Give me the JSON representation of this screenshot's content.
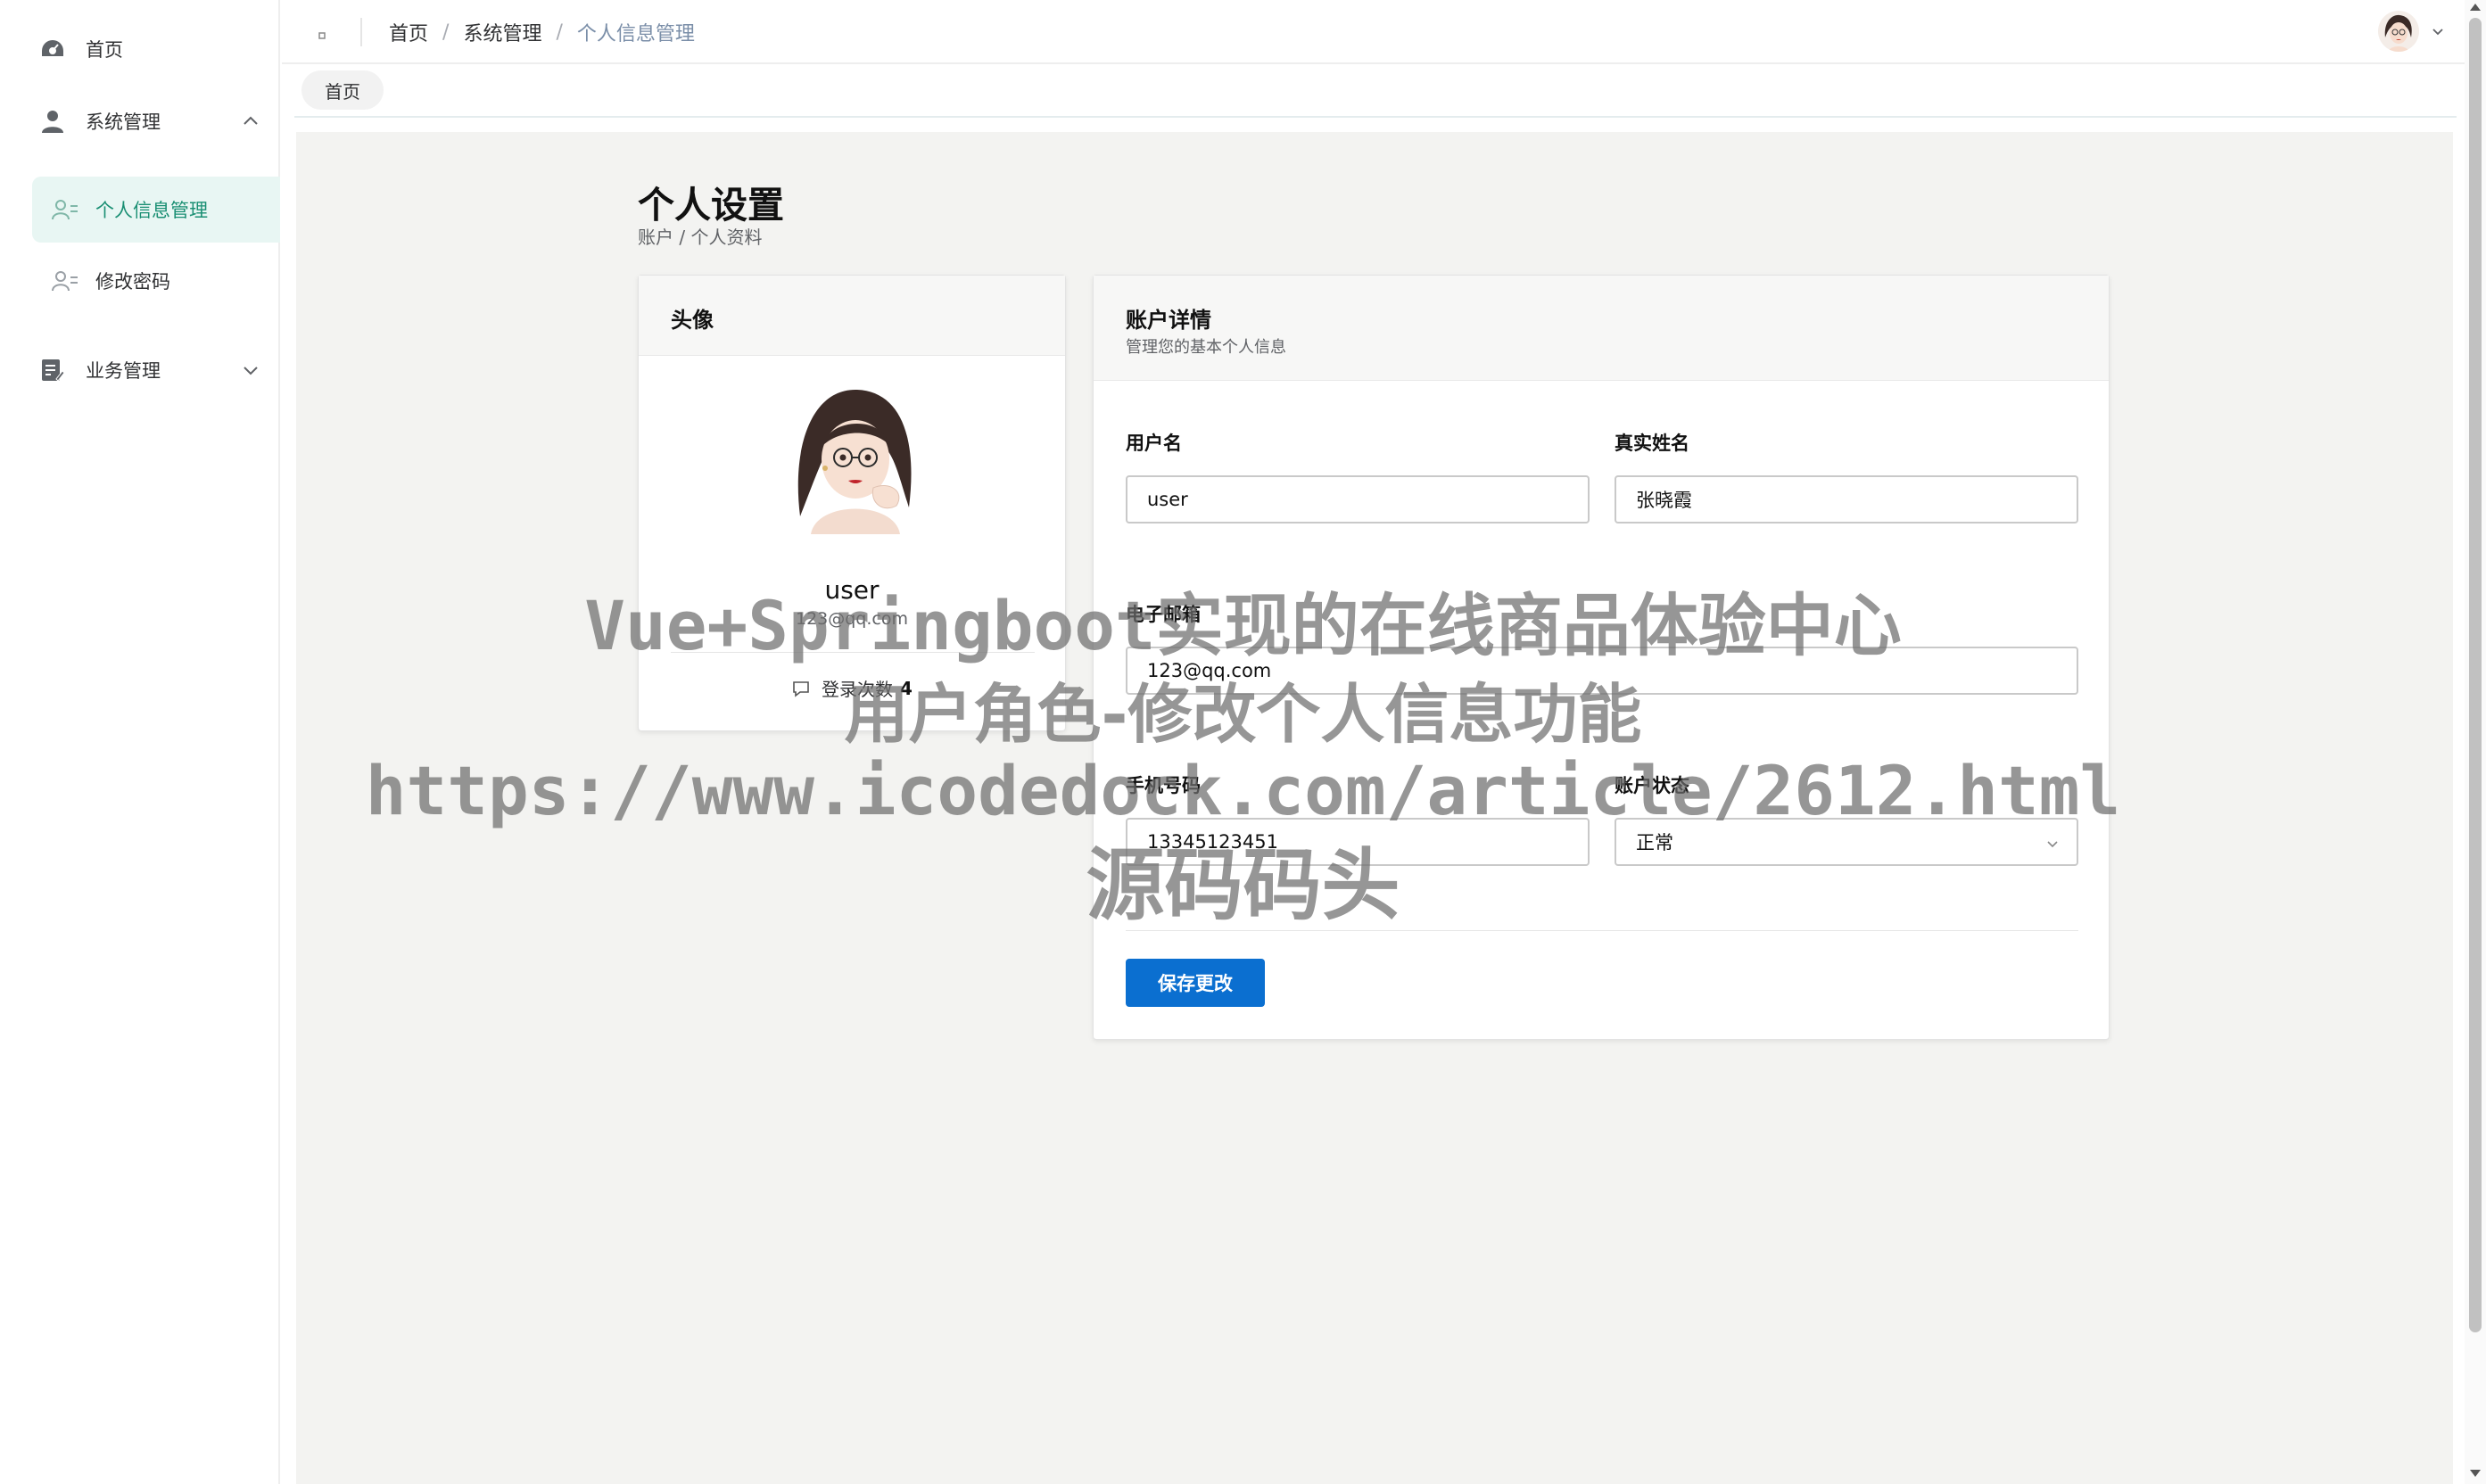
{
  "sidebar": {
    "home": {
      "label": "首页",
      "icon": "dashboard-icon"
    },
    "system": {
      "label": "系统管理",
      "icon": "user-icon",
      "expanded": true,
      "items": [
        {
          "label": "个人信息管理",
          "icon": "user-list-icon",
          "active": true
        },
        {
          "label": "修改密码",
          "icon": "user-list-icon",
          "active": false
        }
      ]
    },
    "business": {
      "label": "业务管理",
      "icon": "document-edit-icon",
      "expanded": false
    }
  },
  "header": {
    "breadcrumb": [
      "首页",
      "系统管理",
      "个人信息管理"
    ],
    "separator": "/"
  },
  "tags": {
    "home": "首页"
  },
  "page": {
    "title": "个人设置",
    "subtitle": "账户 / 个人资料"
  },
  "avatar_card": {
    "title": "头像",
    "username": "user",
    "email": "123@qq.com",
    "login_label": "登录次数",
    "login_count": "4"
  },
  "detail_card": {
    "title": "账户详情",
    "subtitle": "管理您的基本个人信息",
    "fields": {
      "username": {
        "label": "用户名",
        "value": "user"
      },
      "realname": {
        "label": "真实姓名",
        "value": "张晓霞"
      },
      "email": {
        "label": "电子邮箱",
        "value": "123@qq.com"
      },
      "phone": {
        "label": "手机号码",
        "value": "13345123451"
      },
      "status": {
        "label": "账户状态",
        "value": "正常"
      }
    },
    "save_label": "保存更改"
  },
  "watermark": {
    "line1": "Vue+Springboot实现的在线商品体验中心",
    "line2": "用户角色-修改个人信息功能",
    "line3": "https://www.icodedock.com/article/2612.html",
    "line4": "源码码头"
  },
  "colors": {
    "accent": "#1a8f73",
    "active_bg": "#e8f6f3",
    "primary_button": "#0b6fd0",
    "content_bg": "#f3f3f1"
  }
}
